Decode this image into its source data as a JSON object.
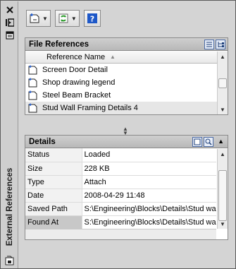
{
  "palette_title": "External References",
  "file_references": {
    "title": "File References",
    "column_header": "Reference Name",
    "items": [
      {
        "name": "Screen Door Detail"
      },
      {
        "name": "Shop drawing legend"
      },
      {
        "name": "Steel Beam Bracket"
      },
      {
        "name": "Stud Wall Framing Details 4"
      }
    ]
  },
  "details": {
    "title": "Details",
    "rows": [
      {
        "key": "Status",
        "value": "Loaded"
      },
      {
        "key": "Size",
        "value": "228 KB"
      },
      {
        "key": "Type",
        "value": "Attach"
      },
      {
        "key": "Date",
        "value": "2008-04-29 11:48"
      },
      {
        "key": "Saved Path",
        "value": "S:\\Engineering\\Blocks\\Details\\Stud wa"
      },
      {
        "key": "Found At",
        "value": "S:\\Engineering\\Blocks\\Details\\Stud wa"
      }
    ]
  },
  "icons": {
    "close": "close-icon",
    "autohide": "autohide-icon",
    "properties": "properties-icon",
    "attach": "attach-dwg-icon",
    "refresh": "refresh-icon",
    "help": "help-icon",
    "list_view": "list-view-icon",
    "tree_view": "tree-view-icon",
    "details_view": "details-view-icon",
    "preview_view": "preview-icon",
    "collapse": "collapse-up-icon"
  },
  "colors": {
    "panel_header": "#bcbcbc",
    "selection": "#e6e6e6",
    "accent_blue": "#1e58c8"
  }
}
